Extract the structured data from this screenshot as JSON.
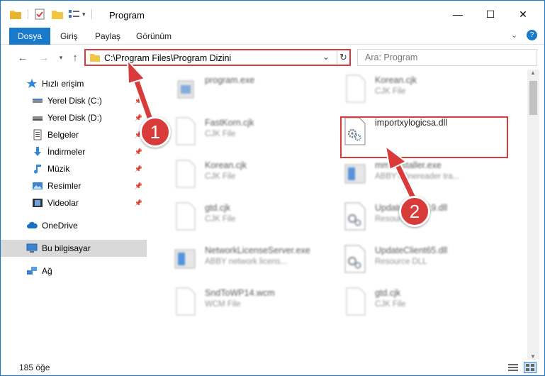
{
  "window": {
    "title": "Program",
    "minimize_glyph": "—",
    "maximize_glyph": "☐",
    "close_glyph": "✕"
  },
  "ribbon": {
    "tabs": [
      "Dosya",
      "Giriş",
      "Paylaş",
      "Görünüm"
    ],
    "help_glyph": "?"
  },
  "address": {
    "path": "C:\\Program Files\\Program Dizini",
    "search_placeholder": "Ara: Program"
  },
  "sidebar": {
    "items": [
      {
        "label": "Hızlı erişim",
        "icon": "star-icon",
        "pinned": false
      },
      {
        "label": "Yerel Disk (C:)",
        "icon": "drive-icon",
        "pinned": true
      },
      {
        "label": "Yerel Disk (D:)",
        "icon": "drive-icon",
        "pinned": true
      },
      {
        "label": "Belgeler",
        "icon": "documents-icon",
        "pinned": true
      },
      {
        "label": "İndirmeler",
        "icon": "download-icon",
        "pinned": true
      },
      {
        "label": "Müzik",
        "icon": "music-icon",
        "pinned": true
      },
      {
        "label": "Resimler",
        "icon": "pictures-icon",
        "pinned": true
      },
      {
        "label": "Videolar",
        "icon": "videos-icon",
        "pinned": true
      },
      {
        "label": "OneDrive",
        "icon": "cloud-icon",
        "pinned": false
      },
      {
        "label": "Bu bilgisayar",
        "icon": "computer-icon",
        "pinned": false
      },
      {
        "label": "Ağ",
        "icon": "network-icon",
        "pinned": false
      }
    ]
  },
  "files": [
    {
      "name": "program.exe",
      "type": "",
      "icon": "exe-icon"
    },
    {
      "name": "Korean.cjk",
      "type": "CJK File",
      "icon": "blank-file-icon"
    },
    {
      "name": "FastKorn.cjk",
      "type": "CJK File",
      "icon": "blank-file-icon"
    },
    {
      "name": "importxylogicsa.dll",
      "type": "",
      "icon": "dll-gear-icon"
    },
    {
      "name": "Korean.cjk",
      "type": "CJK File",
      "icon": "blank-file-icon"
    },
    {
      "name": "mmsInstaller.exe",
      "type": "ABBYY finereader tra...",
      "icon": "installer-icon"
    },
    {
      "name": "gtd.cjk",
      "type": "CJK File",
      "icon": "blank-file-icon"
    },
    {
      "name": "UpdateClient19.dll",
      "type": "Resource DLL",
      "icon": "dll-gear-icon"
    },
    {
      "name": "NetworkLicenseServer.exe",
      "type": "ABBY network licens...",
      "icon": "installer-icon"
    },
    {
      "name": "UpdateClient65.dll",
      "type": "Resource DLL",
      "icon": "dll-gear-icon"
    },
    {
      "name": "SndToWP14.wcm",
      "type": "WCM File",
      "icon": "blank-file-icon"
    },
    {
      "name": "gtd.cjk",
      "type": "CJK File",
      "icon": "blank-file-icon"
    }
  ],
  "status": {
    "item_count": "185 öğe"
  },
  "annotations": {
    "step1": "1",
    "step2": "2",
    "accent": "#d93a3a"
  }
}
